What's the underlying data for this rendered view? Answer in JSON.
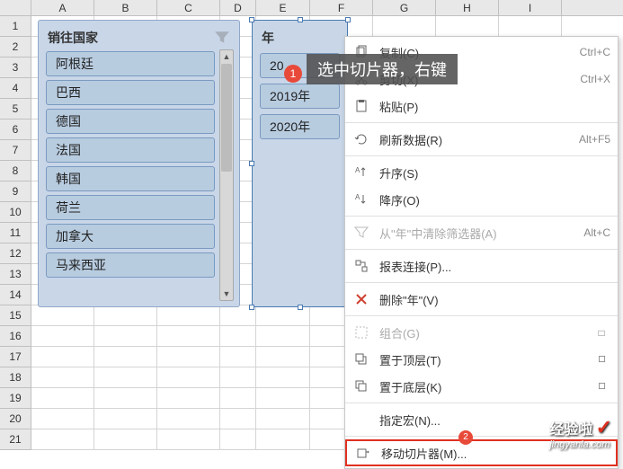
{
  "grid": {
    "cols": [
      "A",
      "B",
      "C",
      "D",
      "E",
      "F",
      "G",
      "H",
      "I"
    ],
    "rows": [
      "1",
      "2",
      "3",
      "4",
      "5",
      "6",
      "7",
      "8",
      "9",
      "10",
      "11",
      "12",
      "13",
      "14",
      "15",
      "16",
      "17",
      "18",
      "19",
      "20",
      "21"
    ]
  },
  "slicer1": {
    "title": "销往国家",
    "items": [
      "阿根廷",
      "巴西",
      "德国",
      "法国",
      "韩国",
      "荷兰",
      "加拿大",
      "马来西亚"
    ]
  },
  "slicer2": {
    "title": "年",
    "items": [
      "2018年",
      "2019年",
      "2020年"
    ],
    "visible_first_prefix": "20"
  },
  "badge1": "1",
  "tooltip": "选中切片器，右键",
  "ctx": {
    "copy": {
      "label": "复制(C)",
      "shortcut": "Ctrl+C"
    },
    "cut": {
      "label": "剪切(X)",
      "shortcut": "Ctrl+X"
    },
    "paste": {
      "label": "粘贴(P)"
    },
    "refresh": {
      "label": "刷新数据(R)",
      "shortcut": "Alt+F5"
    },
    "asc": {
      "label": "升序(S)"
    },
    "desc": {
      "label": "降序(O)"
    },
    "clear": {
      "label": "从\"年\"中清除筛选器(A)",
      "shortcut": "Alt+C"
    },
    "conn": {
      "label": "报表连接(P)..."
    },
    "delete": {
      "label": "删除\"年\"(V)"
    },
    "group": {
      "label": "组合(G)"
    },
    "top": {
      "label": "置于顶层(T)"
    },
    "bottom": {
      "label": "置于底层(K)"
    },
    "macro": {
      "label": "指定宏(N)..."
    },
    "move": {
      "label": "移动切片器(M)..."
    }
  },
  "badge2": "2",
  "watermark": {
    "top": "经验啦",
    "bottom": "jingyanla.com"
  }
}
